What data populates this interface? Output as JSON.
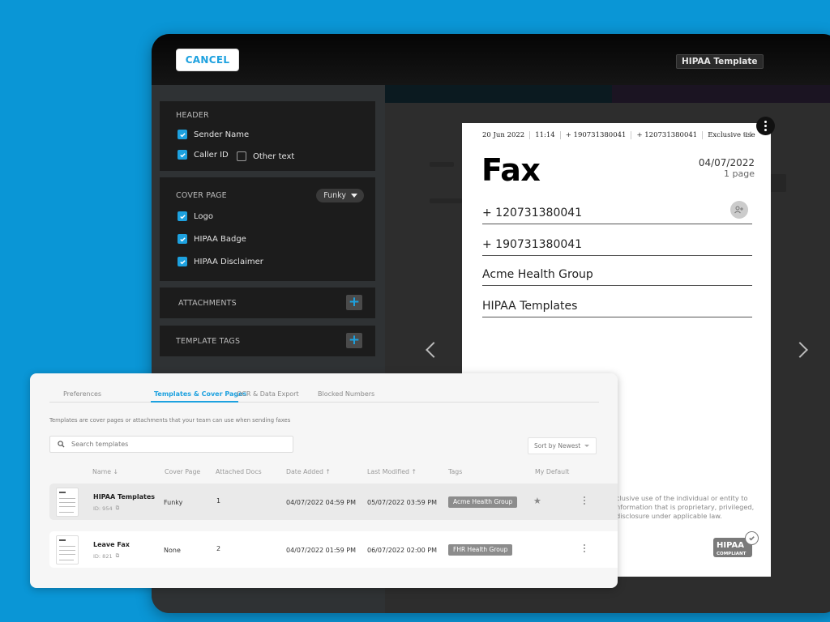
{
  "window": {
    "cancel_label": "CANCEL",
    "template_title": "HIPAA Template"
  },
  "editor": {
    "header_panel": {
      "title": "HEADER",
      "options": [
        {
          "label": "Sender Name",
          "checked": true
        },
        {
          "label": "Caller ID",
          "checked": true
        },
        {
          "label": "Other text",
          "checked": false
        }
      ]
    },
    "cover_panel": {
      "title": "COVER PAGE",
      "style_select": "Funky",
      "options": [
        {
          "label": "Logo",
          "checked": true
        },
        {
          "label": "HIPAA Badge",
          "checked": true
        },
        {
          "label": "HIPAA Disclaimer",
          "checked": true
        }
      ]
    },
    "attachments_label": "ATTACHMENTS",
    "tags_label": "TEMPLATE TAGS",
    "add_symbol": "+"
  },
  "fax_preview": {
    "meta": [
      "20 Jun 2022",
      "11:14",
      "+ 190731380041",
      "+ 120731380041",
      "Exclusive use"
    ],
    "page_no": "P.1",
    "title": "Fax",
    "date": "04/07/2022",
    "pages": "1 page",
    "fields": [
      "+ 120731380041",
      "+ 190731380041",
      "Acme Health Group",
      "HIPAA Templates"
    ],
    "disclaimer_lines": [
      "clusive use of the individual or entity to",
      "nformation that is proprietary, privileged,",
      "disclosure under applicable law."
    ],
    "badge_main": "HIPAA",
    "badge_sub": "COMPLIANT"
  },
  "settings": {
    "tabs": [
      {
        "label": "Preferences",
        "active": false
      },
      {
        "label": "Templates & Cover Pages",
        "active": true
      },
      {
        "label": "OCR & Data Export",
        "active": false
      },
      {
        "label": "Blocked Numbers",
        "active": false
      }
    ],
    "description": "Templates are cover pages or attachments that your team can use when sending faxes",
    "search_placeholder": "Search templates",
    "sort_label": "Sort by Newest",
    "columns": [
      "Name ↓",
      "Cover Page",
      "Attached Docs",
      "Date Added ↑",
      "Last Modified ↑",
      "Tags",
      "My Default"
    ],
    "rows": [
      {
        "name": "HIPAA Templates",
        "id": "ID: 954",
        "cover": "Funky",
        "docs": "1",
        "added": "04/07/2022 04:59 PM",
        "modified": "05/07/2022 03:59 PM",
        "tag": "Acme Health Group",
        "default": true
      },
      {
        "name": "Leave Fax",
        "id": "ID: 821",
        "cover": "None",
        "docs": "2",
        "added": "04/07/2022 01:59 PM",
        "modified": "06/07/2022 02:00 PM",
        "tag": "FHR Health Group",
        "default": false
      }
    ]
  },
  "colors": {
    "accent": "#1da1df",
    "background": "#0a96d6",
    "tag": "#8c8c8c"
  }
}
